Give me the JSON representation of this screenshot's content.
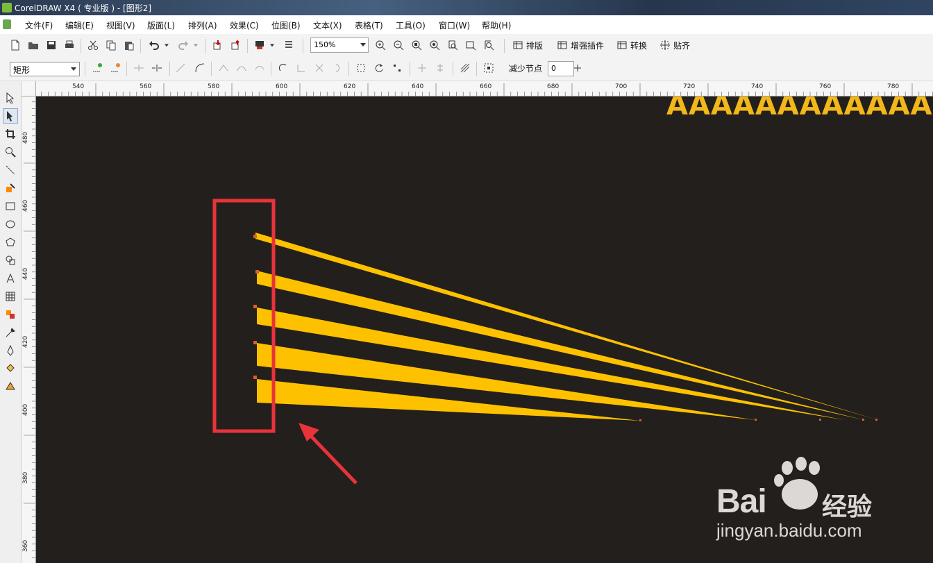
{
  "window": {
    "title": "CorelDRAW X4 ( 专业版 ) - [图形2]"
  },
  "menu": [
    "文件(F)",
    "编辑(E)",
    "视图(V)",
    "版面(L)",
    "排列(A)",
    "效果(C)",
    "位图(B)",
    "文本(X)",
    "表格(T)",
    "工具(O)",
    "窗口(W)",
    "帮助(H)"
  ],
  "toolbar": {
    "zoom_value": "150%",
    "plugin_labels": [
      "排版",
      "增强插件",
      "转换",
      "贴齐"
    ]
  },
  "property_bar": {
    "shape_select": "矩形",
    "reduce_nodes_label": "减少节点",
    "reduce_nodes_value": "0"
  },
  "rulers": {
    "horizontal": [
      "540",
      "560",
      "580",
      "600",
      "620",
      "640",
      "660",
      "680",
      "700",
      "720",
      "740",
      "760",
      "780"
    ],
    "vertical": [
      "480",
      "460",
      "440",
      "420",
      "400",
      "380",
      "360"
    ]
  },
  "canvas": {
    "background": "#231f1c",
    "headline_text": "AAAAAAAAAAAAAAA",
    "shape_color": "#fdc100",
    "highlight_color": "#e8333a"
  },
  "watermark": {
    "brand": "Bai",
    "brand_cn": "经验",
    "url": "jingyan.baidu.com"
  }
}
